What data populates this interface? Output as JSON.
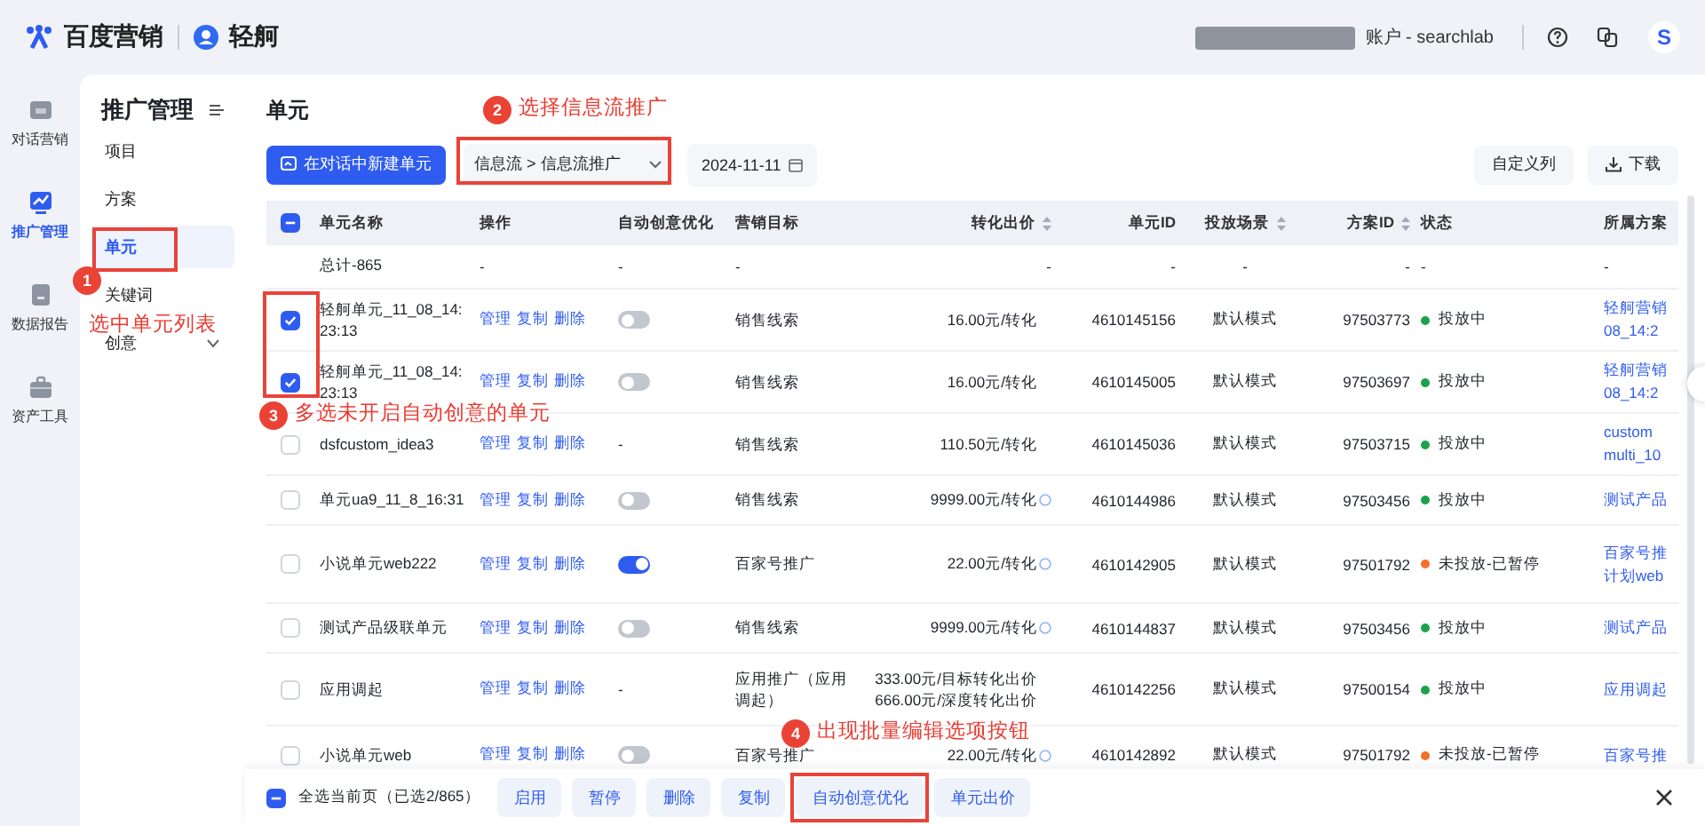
{
  "header": {
    "brand": "百度营销",
    "product": "轻舸",
    "account": "账户 - searchlab",
    "avatar": "S"
  },
  "nav": [
    {
      "label": "对话营销",
      "selected": false
    },
    {
      "label": "推广管理",
      "selected": true
    },
    {
      "label": "数据报告",
      "selected": false
    },
    {
      "label": "资产工具",
      "selected": false
    }
  ],
  "sidebar": {
    "title": "推广管理",
    "items": [
      {
        "label": "项目",
        "selected": false
      },
      {
        "label": "方案",
        "selected": false
      },
      {
        "label": "单元",
        "selected": true
      },
      {
        "label": "关键词",
        "selected": false
      },
      {
        "label": "创意",
        "selected": false,
        "expanded": false
      }
    ]
  },
  "page": {
    "title": "单元",
    "new_button": "在对话中新建单元",
    "channel_select": "信息流 > 信息流推广",
    "date": "2024-11-11",
    "custom_columns": "自定义列",
    "download": "下载"
  },
  "table": {
    "select_all": {
      "indeterminate": true
    },
    "columns": [
      {
        "label": "单元名称",
        "sortable": false
      },
      {
        "label": "操作",
        "sortable": false
      },
      {
        "label": "自动创意优化",
        "sortable": false
      },
      {
        "label": "营销目标",
        "sortable": false
      },
      {
        "label": "转化出价",
        "sortable": true
      },
      {
        "label": "单元ID",
        "sortable": false
      },
      {
        "label": "投放场景",
        "sortable": true
      },
      {
        "label": "方案ID",
        "sortable": true
      },
      {
        "label": "状态",
        "sortable": false
      },
      {
        "label": "所属方案",
        "sortable": false
      }
    ],
    "total": {
      "name": "总计-865",
      "cells": [
        "-",
        "-",
        "-",
        "-",
        "-",
        "-",
        "-",
        "-",
        "-"
      ]
    },
    "rows": [
      {
        "checked": true,
        "name": "轻舸单元_11_08_14:23:13",
        "actions": [
          "管理",
          "复制",
          "删除"
        ],
        "auto": {
          "kind": "toggle",
          "on": false
        },
        "goal": "销售线索",
        "bid": [
          "16.00元/转化"
        ],
        "bid_info": false,
        "unit_id": "4610145156",
        "scene": "默认模式",
        "plan_id": "97503773",
        "status": "投放中",
        "color": "#1aa34a",
        "plan": [
          "轻舸营销",
          "08_14:2"
        ]
      },
      {
        "checked": true,
        "name": "轻舸单元_11_08_14:23:13",
        "actions": [
          "管理",
          "复制",
          "删除"
        ],
        "auto": {
          "kind": "toggle",
          "on": false
        },
        "goal": "销售线索",
        "bid": [
          "16.00元/转化"
        ],
        "bid_info": false,
        "unit_id": "4610145005",
        "scene": "默认模式",
        "plan_id": "97503697",
        "status": "投放中",
        "color": "#1aa34a",
        "plan": [
          "轻舸营销",
          "08_14:2"
        ]
      },
      {
        "checked": false,
        "name": "dsfcustom_idea3",
        "actions": [
          "管理",
          "复制",
          "删除"
        ],
        "auto": {
          "kind": "text",
          "text": "-"
        },
        "goal": "销售线索",
        "bid": [
          "110.50元/转化"
        ],
        "bid_info": false,
        "unit_id": "4610145036",
        "scene": "默认模式",
        "plan_id": "97503715",
        "status": "投放中",
        "color": "#1aa34a",
        "plan": [
          "custom",
          "multi_10"
        ]
      },
      {
        "checked": false,
        "name": "单元ua9_11_8_16:31",
        "actions": [
          "管理",
          "复制",
          "删除"
        ],
        "auto": {
          "kind": "toggle",
          "on": false
        },
        "goal": "销售线索",
        "bid": [
          "9999.00元/转化"
        ],
        "bid_info": true,
        "unit_id": "4610144986",
        "scene": "默认模式",
        "plan_id": "97503456",
        "status": "投放中",
        "color": "#1aa34a",
        "plan": [
          "测试产品"
        ]
      },
      {
        "checked": false,
        "name": "小说单元web222",
        "actions": [
          "管理",
          "复制",
          "删除"
        ],
        "auto": {
          "kind": "toggle",
          "on": true
        },
        "goal": "百家号推广",
        "bid": [
          "22.00元/转化"
        ],
        "bid_info": true,
        "unit_id": "4610142905",
        "scene": "默认模式",
        "plan_id": "97501792",
        "status": "未投放-已暂停",
        "color": "#f56e2a",
        "plan": [
          "百家号推",
          "计划web"
        ]
      },
      {
        "checked": false,
        "name": "测试产品级联单元",
        "actions": [
          "管理",
          "复制",
          "删除"
        ],
        "auto": {
          "kind": "toggle",
          "on": false
        },
        "goal": "销售线索",
        "bid": [
          "9999.00元/转化"
        ],
        "bid_info": true,
        "unit_id": "4610144837",
        "scene": "默认模式",
        "plan_id": "97503456",
        "status": "投放中",
        "color": "#1aa34a",
        "plan": [
          "测试产品"
        ]
      },
      {
        "checked": false,
        "name": "应用调起",
        "actions": [
          "管理",
          "复制",
          "删除"
        ],
        "auto": {
          "kind": "text",
          "text": "-"
        },
        "goal": "应用推广（应用调起）",
        "bid": [
          "333.00元/目标转化出价",
          "666.00元/深度转化出价"
        ],
        "bid_info": false,
        "unit_id": "4610142256",
        "scene": "默认模式",
        "plan_id": "97500154",
        "status": "投放中",
        "color": "#1aa34a",
        "plan": [
          "应用调起"
        ]
      },
      {
        "checked": false,
        "name": "小说单元web",
        "actions": [
          "管理",
          "复制",
          "删除"
        ],
        "auto": {
          "kind": "toggle",
          "on": false
        },
        "goal": "百家号推广",
        "bid": [
          "22.00元/转化"
        ],
        "bid_info": true,
        "unit_id": "4610142892",
        "scene": "默认模式",
        "plan_id": "97501792",
        "status": "未投放-已暂停",
        "color": "#f56e2a",
        "plan": [
          "百家号推"
        ]
      }
    ]
  },
  "bulk_bar": {
    "indeterminate": true,
    "label": "全选当前页（已选2/865）",
    "buttons": [
      "启用",
      "暂停",
      "删除",
      "复制",
      "自动创意优化",
      "单元出价"
    ]
  },
  "annotations": [
    {
      "number": "1",
      "text": "选中单元列表"
    },
    {
      "number": "2",
      "text": "选择信息流推广"
    },
    {
      "number": "3",
      "text": "多选未开启自动创意的单元"
    },
    {
      "number": "4",
      "text": "出现批量编辑选项按钮"
    }
  ]
}
